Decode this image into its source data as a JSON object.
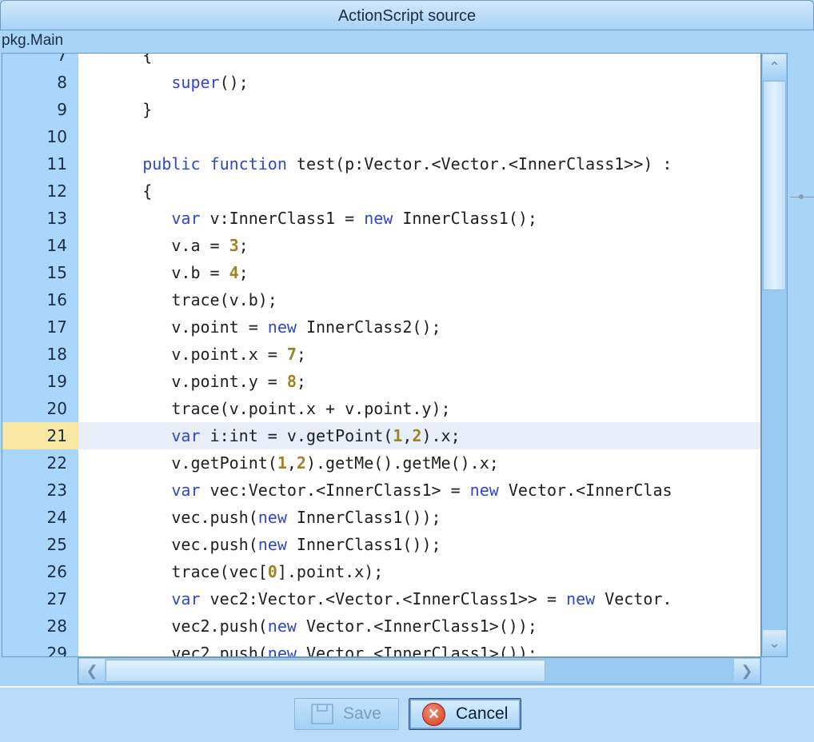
{
  "window": {
    "title": "ActionScript source"
  },
  "class_name": "pkg.Main",
  "editor": {
    "current_line": 21,
    "lines": [
      {
        "n": "7",
        "tokens": [
          [
            "t",
            "      {"
          ]
        ]
      },
      {
        "n": "8",
        "tokens": [
          [
            "t",
            "         "
          ],
          [
            "kw",
            "super"
          ],
          [
            "t",
            "();"
          ]
        ]
      },
      {
        "n": "9",
        "tokens": [
          [
            "t",
            "      }"
          ]
        ]
      },
      {
        "n": "10",
        "tokens": []
      },
      {
        "n": "11",
        "tokens": [
          [
            "t",
            "      "
          ],
          [
            "kw",
            "public"
          ],
          [
            "t",
            " "
          ],
          [
            "kw",
            "function"
          ],
          [
            "t",
            " test(p:Vector.<Vector.<InnerClass1>>) :"
          ]
        ]
      },
      {
        "n": "12",
        "tokens": [
          [
            "t",
            "      {"
          ]
        ]
      },
      {
        "n": "13",
        "tokens": [
          [
            "t",
            "         "
          ],
          [
            "kw",
            "var"
          ],
          [
            "t",
            " v:InnerClass1 = "
          ],
          [
            "kw",
            "new"
          ],
          [
            "t",
            " InnerClass1();"
          ]
        ]
      },
      {
        "n": "14",
        "tokens": [
          [
            "t",
            "         v.a = "
          ],
          [
            "num",
            "3"
          ],
          [
            "t",
            ";"
          ]
        ]
      },
      {
        "n": "15",
        "tokens": [
          [
            "t",
            "         v.b = "
          ],
          [
            "num",
            "4"
          ],
          [
            "t",
            ";"
          ]
        ]
      },
      {
        "n": "16",
        "tokens": [
          [
            "t",
            "         trace(v.b);"
          ]
        ]
      },
      {
        "n": "17",
        "tokens": [
          [
            "t",
            "         v.point = "
          ],
          [
            "kw",
            "new"
          ],
          [
            "t",
            " InnerClass2();"
          ]
        ]
      },
      {
        "n": "18",
        "tokens": [
          [
            "t",
            "         v.point.x = "
          ],
          [
            "num",
            "7"
          ],
          [
            "t",
            ";"
          ]
        ]
      },
      {
        "n": "19",
        "tokens": [
          [
            "t",
            "         v.point.y = "
          ],
          [
            "num",
            "8"
          ],
          [
            "t",
            ";"
          ]
        ]
      },
      {
        "n": "20",
        "tokens": [
          [
            "t",
            "         trace(v.point.x + v.point.y);"
          ]
        ]
      },
      {
        "n": "21",
        "tokens": [
          [
            "t",
            "         "
          ],
          [
            "kw",
            "var"
          ],
          [
            "t",
            " i:int = v.getPoint("
          ],
          [
            "num",
            "1"
          ],
          [
            "t",
            ","
          ],
          [
            "num",
            "2"
          ],
          [
            "t",
            ").x;"
          ]
        ]
      },
      {
        "n": "22",
        "tokens": [
          [
            "t",
            "         v.getPoint("
          ],
          [
            "num",
            "1"
          ],
          [
            "t",
            ","
          ],
          [
            "num",
            "2"
          ],
          [
            "t",
            ").getMe().getMe().x;"
          ]
        ]
      },
      {
        "n": "23",
        "tokens": [
          [
            "t",
            "         "
          ],
          [
            "kw",
            "var"
          ],
          [
            "t",
            " vec:Vector.<InnerClass1> = "
          ],
          [
            "kw",
            "new"
          ],
          [
            "t",
            " Vector.<InnerClas"
          ]
        ]
      },
      {
        "n": "24",
        "tokens": [
          [
            "t",
            "         vec.push("
          ],
          [
            "kw",
            "new"
          ],
          [
            "t",
            " InnerClass1());"
          ]
        ]
      },
      {
        "n": "25",
        "tokens": [
          [
            "t",
            "         vec.push("
          ],
          [
            "kw",
            "new"
          ],
          [
            "t",
            " InnerClass1());"
          ]
        ]
      },
      {
        "n": "26",
        "tokens": [
          [
            "t",
            "         trace(vec["
          ],
          [
            "num",
            "0"
          ],
          [
            "t",
            "].point.x);"
          ]
        ]
      },
      {
        "n": "27",
        "tokens": [
          [
            "t",
            "         "
          ],
          [
            "kw",
            "var"
          ],
          [
            "t",
            " vec2:Vector.<Vector.<InnerClass1>> = "
          ],
          [
            "kw",
            "new"
          ],
          [
            "t",
            " Vector."
          ]
        ]
      },
      {
        "n": "28",
        "tokens": [
          [
            "t",
            "         vec2.push("
          ],
          [
            "kw",
            "new"
          ],
          [
            "t",
            " Vector.<InnerClass1>());"
          ]
        ]
      },
      {
        "n": "29",
        "tokens": [
          [
            "t",
            "         vec2.push("
          ],
          [
            "kw",
            "new"
          ],
          [
            "t",
            " Vector.<InnerClass1>());"
          ]
        ]
      }
    ]
  },
  "buttons": {
    "save_label": "Save",
    "save_enabled": false,
    "cancel_label": "Cancel"
  },
  "icons": {
    "save": "floppy-disk-icon",
    "cancel": "cancel-x-icon",
    "scroll_up": "arrow-up-icon",
    "scroll_down": "arrow-down-icon",
    "scroll_left": "arrow-left-icon",
    "scroll_right": "arrow-right-icon"
  },
  "colors": {
    "keyword": "#3045d0",
    "number": "#9a8420",
    "gutter": "#a9d6fa",
    "current_line_number": "#f8e7a3",
    "current_line": "#e8eef7"
  }
}
